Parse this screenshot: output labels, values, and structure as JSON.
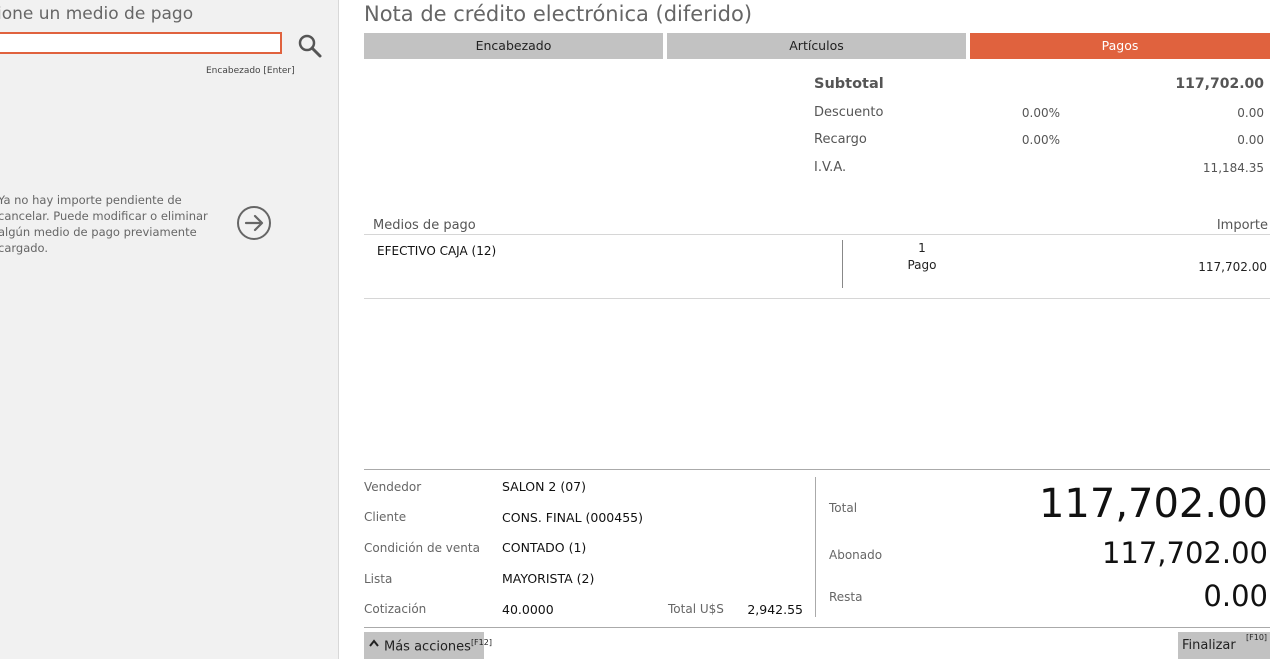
{
  "left": {
    "title": "ione un medio de pago",
    "search_value": "",
    "hint": "Encabezado [Enter]",
    "info_message": "Ya no hay importe pendiente de cancelar. Puede modificar o eliminar algún medio de pago previamente cargado."
  },
  "doc": {
    "title": "Nota de crédito electrónica (diferido)"
  },
  "tabs": [
    {
      "label": "Encabezado"
    },
    {
      "label": "Artículos"
    },
    {
      "label": "Pagos"
    }
  ],
  "totals": {
    "subtotal_label": "Subtotal",
    "subtotal_value": "117,702.00",
    "descuento_label": "Descuento",
    "descuento_pct": "0.00%",
    "descuento_value": "0.00",
    "recargo_label": "Recargo",
    "recargo_pct": "0.00%",
    "recargo_value": "0.00",
    "iva_label": "I.V.A.",
    "iva_value": "11,184.35"
  },
  "payments": {
    "header_label": "Medios de pago",
    "header_amount": "Importe",
    "rows": [
      {
        "name": "EFECTIVO CAJA (12)",
        "count": "1",
        "unit": "Pago",
        "amount": "117,702.00"
      }
    ]
  },
  "info": {
    "vendedor_label": "Vendedor",
    "vendedor": "SALON 2 (07)",
    "cliente_label": "Cliente",
    "cliente": "CONS. FINAL (000455)",
    "condicion_label": "Condición de venta",
    "condicion": "CONTADO  (1)",
    "lista_label": "Lista",
    "lista": "MAYORISTA (2)",
    "cotizacion_label": "Cotización",
    "cotizacion": "40.0000",
    "total_usd_label": "Total U$S",
    "total_usd": "2,942.55"
  },
  "summary": {
    "total_label": "Total",
    "total": "117,702.00",
    "abonado_label": "Abonado",
    "abonado": "117,702.00",
    "resta_label": "Resta",
    "resta": "0.00"
  },
  "actions": {
    "more_label": "Más acciones",
    "more_key": "[F12]",
    "finalize_label": "Finalizar",
    "finalize_key": "[F10]"
  },
  "colors": {
    "accent": "#e0623e",
    "tab_gray": "#c2c2c2",
    "panel_bg": "#f1f1f1"
  }
}
